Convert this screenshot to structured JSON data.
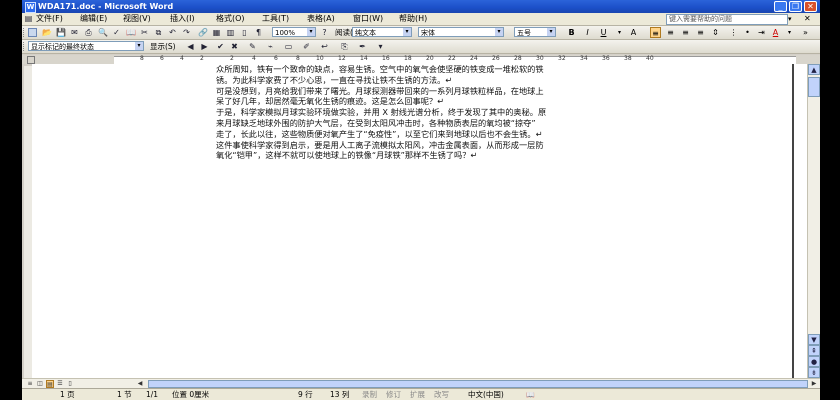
{
  "window": {
    "title": "WDA171.doc - Microsoft Word"
  },
  "menu": {
    "items": [
      "文件(F)",
      "编辑(E)",
      "视图(V)",
      "插入(I)",
      "格式(O)",
      "工具(T)",
      "表格(A)",
      "窗口(W)",
      "帮助(H)"
    ],
    "help_placeholder": "键入需要帮助的问题"
  },
  "toolbar": {
    "zoom": "100%",
    "reading": "阅读(R)",
    "style": "纯文本",
    "font": "宋体",
    "size": "五号",
    "review_display": "显示标记的最终状态",
    "show": "显示(S)"
  },
  "ruler": {
    "ticks": [
      "8",
      "6",
      "4",
      "2",
      "2",
      "4",
      "6",
      "8",
      "10",
      "12",
      "14",
      "16",
      "18",
      "20",
      "22",
      "24",
      "26",
      "28",
      "30",
      "32",
      "34",
      "36",
      "38",
      "40"
    ]
  },
  "document": {
    "lines": [
      "众所周知，铁有一个致命的缺点，容易生锈。空气中的氧气会使坚硬的铁变成一堆松软的铁",
      "锈。为此科学家费了不少心思，一直在寻找让铁不生锈的方法。↵",
      "可是没想到，月亮给我们带来了曙光。月球探测器带回来的一系列月球铁粒样品，在地球上",
      "呆了好几年，却居然毫无氧化生锈的痕迹。这是怎么回事呢？↵",
      "于是，科学家模拟月球实验环境做实验，并用 X 射线光谱分析，终于发现了其中的奥秘。原",
      "来月球缺乏地球外围的防护大气层，在受到太阳风冲击时，各种物质表层的氧均被“掠夺”",
      "走了，长此以往，这些物质便对氧产生了“免疫性”，以至它们来到地球以后也不会生锈。↵",
      "这件事使科学家得到启示，要是用人工离子流模拟太阳风，冲击金属表面，从而形成一层防",
      "氧化“铠甲”，这样不就可以使地球上的铁像“月球铁”那样不生锈了吗？↵"
    ]
  },
  "status": {
    "page": "1 页",
    "section": "1 节",
    "page_of": "1/1",
    "position": "位置 0厘米",
    "line": "9 行",
    "column": "13 列",
    "rec": "录制",
    "trk": "修订",
    "ext": "扩展",
    "ovr": "改写",
    "language": "中文(中国)"
  }
}
